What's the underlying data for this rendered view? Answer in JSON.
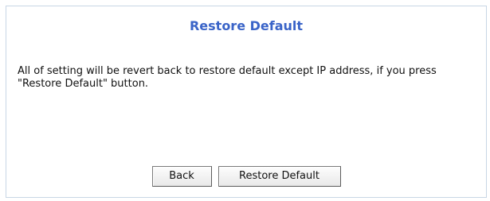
{
  "panel": {
    "title": "Restore Default",
    "message": "All of setting will be revert back to restore default except IP address, if you press \"Restore Default\" button."
  },
  "actions": {
    "back_label": "Back",
    "restore_label": "Restore Default"
  },
  "colors": {
    "title": "#3a64c8",
    "panel_border": "#c8d6e5",
    "text": "#111111"
  }
}
